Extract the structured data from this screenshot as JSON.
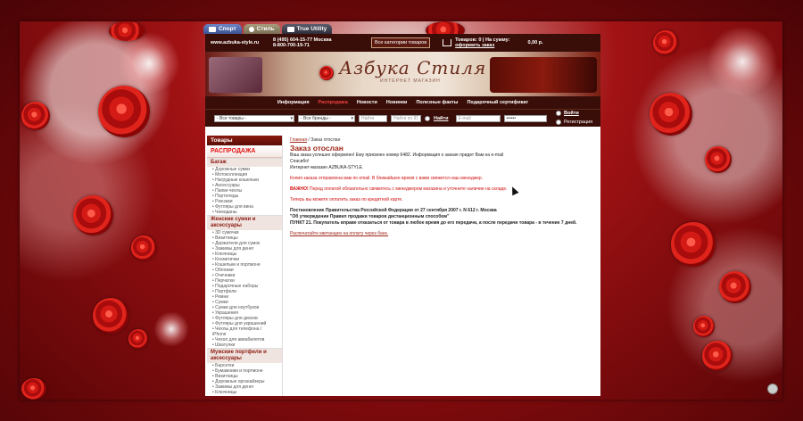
{
  "tabs": [
    {
      "label": "Спорт"
    },
    {
      "label": "Стиль"
    },
    {
      "label": "True Utility"
    }
  ],
  "header": {
    "url": "www.azbuka-style.ru",
    "phone1": "8 (495) 604-15-77 Москва",
    "phone2": "8-800-700-19-71",
    "all_categories": "Все категории товаров",
    "cart_line1": "Товаров: 0 | На сумму:",
    "cart_link": "оформить заказ",
    "cart_sum": "0,00 р."
  },
  "banner": {
    "logo": "Азбука Стиля",
    "sub": "ИНТЕРНЕТ МАГАЗИН"
  },
  "menu": [
    {
      "label": "Информация",
      "hot": false
    },
    {
      "label": "Распродажа",
      "hot": true
    },
    {
      "label": "Новости",
      "hot": false
    },
    {
      "label": "Новинки",
      "hot": false
    },
    {
      "label": "Полезные факты",
      "hot": false
    },
    {
      "label": "Подарочный сертификат",
      "hot": false
    }
  ],
  "filters": {
    "goods": "- Все товары -",
    "brands": "- Все бренды -",
    "find_ph": "Найти",
    "find_id_ph": "Найти по ID",
    "find_link": "Найти",
    "email_ph": "E-mail",
    "pass_ph": "••••••",
    "login": "Войти",
    "register": "Регистрация"
  },
  "sidebar": {
    "title": "Товары",
    "sale": "РАСПРОДАЖА",
    "groups": [
      {
        "name": "Багаж",
        "items": [
          "Дорожные сумки",
          "Мотоколлекция",
          "Нагрудные кошельки",
          "Аксессуары",
          "Папки-чехлы",
          "Портпледы",
          "Рюкзаки",
          "Футляры для вина",
          "Чемоданы"
        ]
      },
      {
        "name": "Женские сумки и аксессуары",
        "items": [
          "3D сумочки",
          "Визитницы",
          "Держатели для сумок",
          "Зажимы для денег",
          "Ключницы",
          "Косметички",
          "Кошельки и портмоне",
          "Обложки",
          "Очечники",
          "Перчатки",
          "Подарочные наборы",
          "Портфели",
          "Ремни",
          "Сумки",
          "Сумки для ноутбуков",
          "Украшения",
          "Футляры для дисков",
          "Футляры для украшений",
          "Чехлы для телефона / iPhone",
          "Чехол для авиабилетов",
          "Шкатулки"
        ]
      },
      {
        "name": "Мужские портфели и аксессуары",
        "items": [
          "Барсетки",
          "Бумажники и портмоне",
          "Визитницы",
          "Дорожные органайзеры",
          "Зажимы для денег",
          "Ключницы"
        ]
      }
    ]
  },
  "main": {
    "crumb_home": "Главная",
    "crumb_sep": " / ",
    "crumb_current": "Заказ отослан",
    "title": "Заказ отослан",
    "p1": "Ваш заказ успешно оформлен! Ему присвоен номер 6482. Информация о заказе придет Вам на e-mail",
    "p2": "Спасибо!",
    "p3": "Интернет-магазин AZBUKA-STYLE.",
    "p4": "Копия заказа отправлена вам по email. В ближайшее время с вами свяжется наш менеджер.",
    "p5_bold": "ВАЖНО!",
    "p5": " Перед оплатой обязательно свяжитесь с менеджером магазина и уточните наличие на складе.",
    "p6": "Теперь вы можете оплатить заказ по кредитной карте.",
    "law1": "Постановление Правительства Российской Федерации от 27 сентября 2007 г. N 612 г. Москва",
    "law2": "\"Об утверждении Правил продажи товаров дистанционным способом\"",
    "law3": "ПУНКТ 21. Покупатель вправе отказаться от товара в любое время до его передачи, а после передачи товара - в течение 7 дней.",
    "print_link": "Распечатайте квитанцию на оплату через банк."
  }
}
